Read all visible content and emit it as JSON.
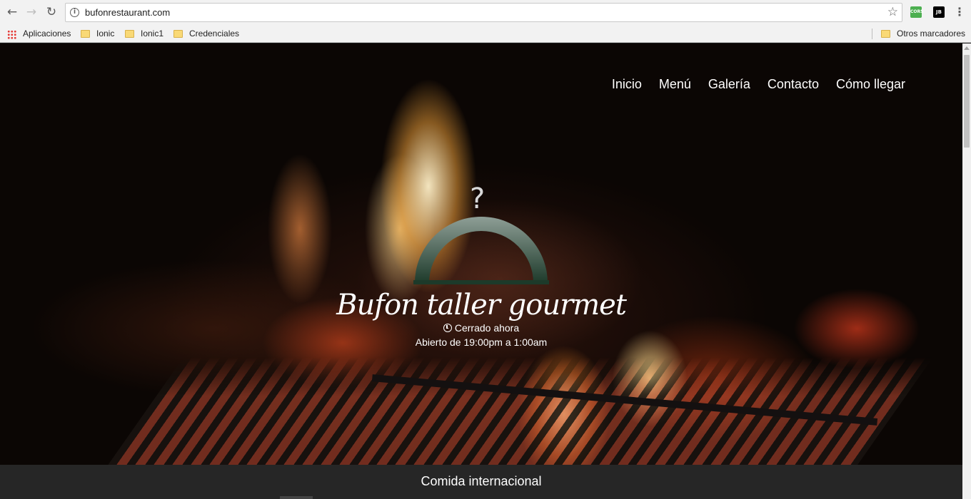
{
  "browser": {
    "url": "bufonrestaurant.com",
    "extensions": [
      {
        "name": "cors-extension-icon",
        "label": "CORS"
      },
      {
        "name": "jb-extension-icon",
        "label": "JB"
      }
    ],
    "bookmarks": [
      {
        "label": "Aplicaciones",
        "icon": "apps-icon"
      },
      {
        "label": "Ionic",
        "icon": "folder-icon"
      },
      {
        "label": "Ionic1",
        "icon": "folder-icon"
      },
      {
        "label": "Credenciales",
        "icon": "folder-icon"
      }
    ],
    "other_bookmarks": "Otros marcadores"
  },
  "site": {
    "nav": [
      "Inicio",
      "Menú",
      "Galería",
      "Contacto",
      "Cómo llegar"
    ],
    "hero": {
      "logo_glyph": "?",
      "title": "Bufon taller gourmet",
      "status": "Cerrado ahora",
      "hours": "Abierto de 19:00pm a 1:00am"
    },
    "strip_text": "Comida internacional"
  },
  "colors": {
    "dome_top": "#8e9e96",
    "dome_bottom": "#1d3a2a",
    "strip_bg": "#262626"
  }
}
